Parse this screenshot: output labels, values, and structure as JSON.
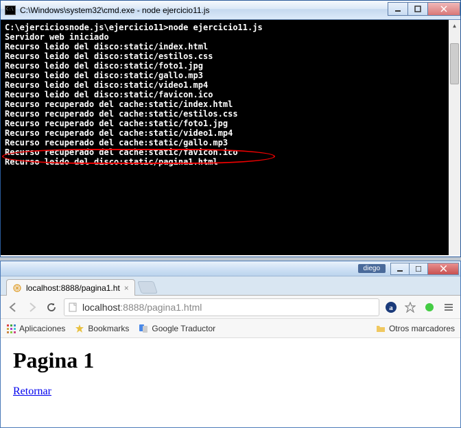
{
  "cmd": {
    "title": "C:\\Windows\\system32\\cmd.exe - node  ejercicio11.js",
    "prompt": "C:\\ejerciciosnode.js\\ejercicio11>node ejercicio11.js",
    "lines": [
      "Servidor web iniciado",
      "Recurso leido del disco:static/index.html",
      "Recurso leido del disco:static/estilos.css",
      "Recurso leido del disco:static/foto1.jpg",
      "Recurso leido del disco:static/gallo.mp3",
      "Recurso leido del disco:static/video1.mp4",
      "Recurso leido del disco:static/favicon.ico",
      "Recurso recuperado del cache:static/index.html",
      "Recurso recuperado del cache:static/estilos.css",
      "Recurso recuperado del cache:static/foto1.jpg",
      "Recurso recuperado del cache:static/video1.mp4",
      "Recurso recuperado del cache:static/gallo.mp3",
      "Recurso recuperado del cache:static/favicon.ico",
      "Recurso leido del disco:static/pagina1.html"
    ]
  },
  "browser": {
    "user": "diego",
    "tab_label": "localhost:8888/pagina1.ht",
    "url_host": "localhost",
    "url_port": ":8888",
    "url_path": "/pagina1.html",
    "bookmarks": {
      "apps": "Aplicaciones",
      "bm": "Bookmarks",
      "gt": "Google Traductor",
      "otros": "Otros marcadores"
    },
    "page": {
      "heading": "Pagina 1",
      "link": "Retornar"
    }
  }
}
